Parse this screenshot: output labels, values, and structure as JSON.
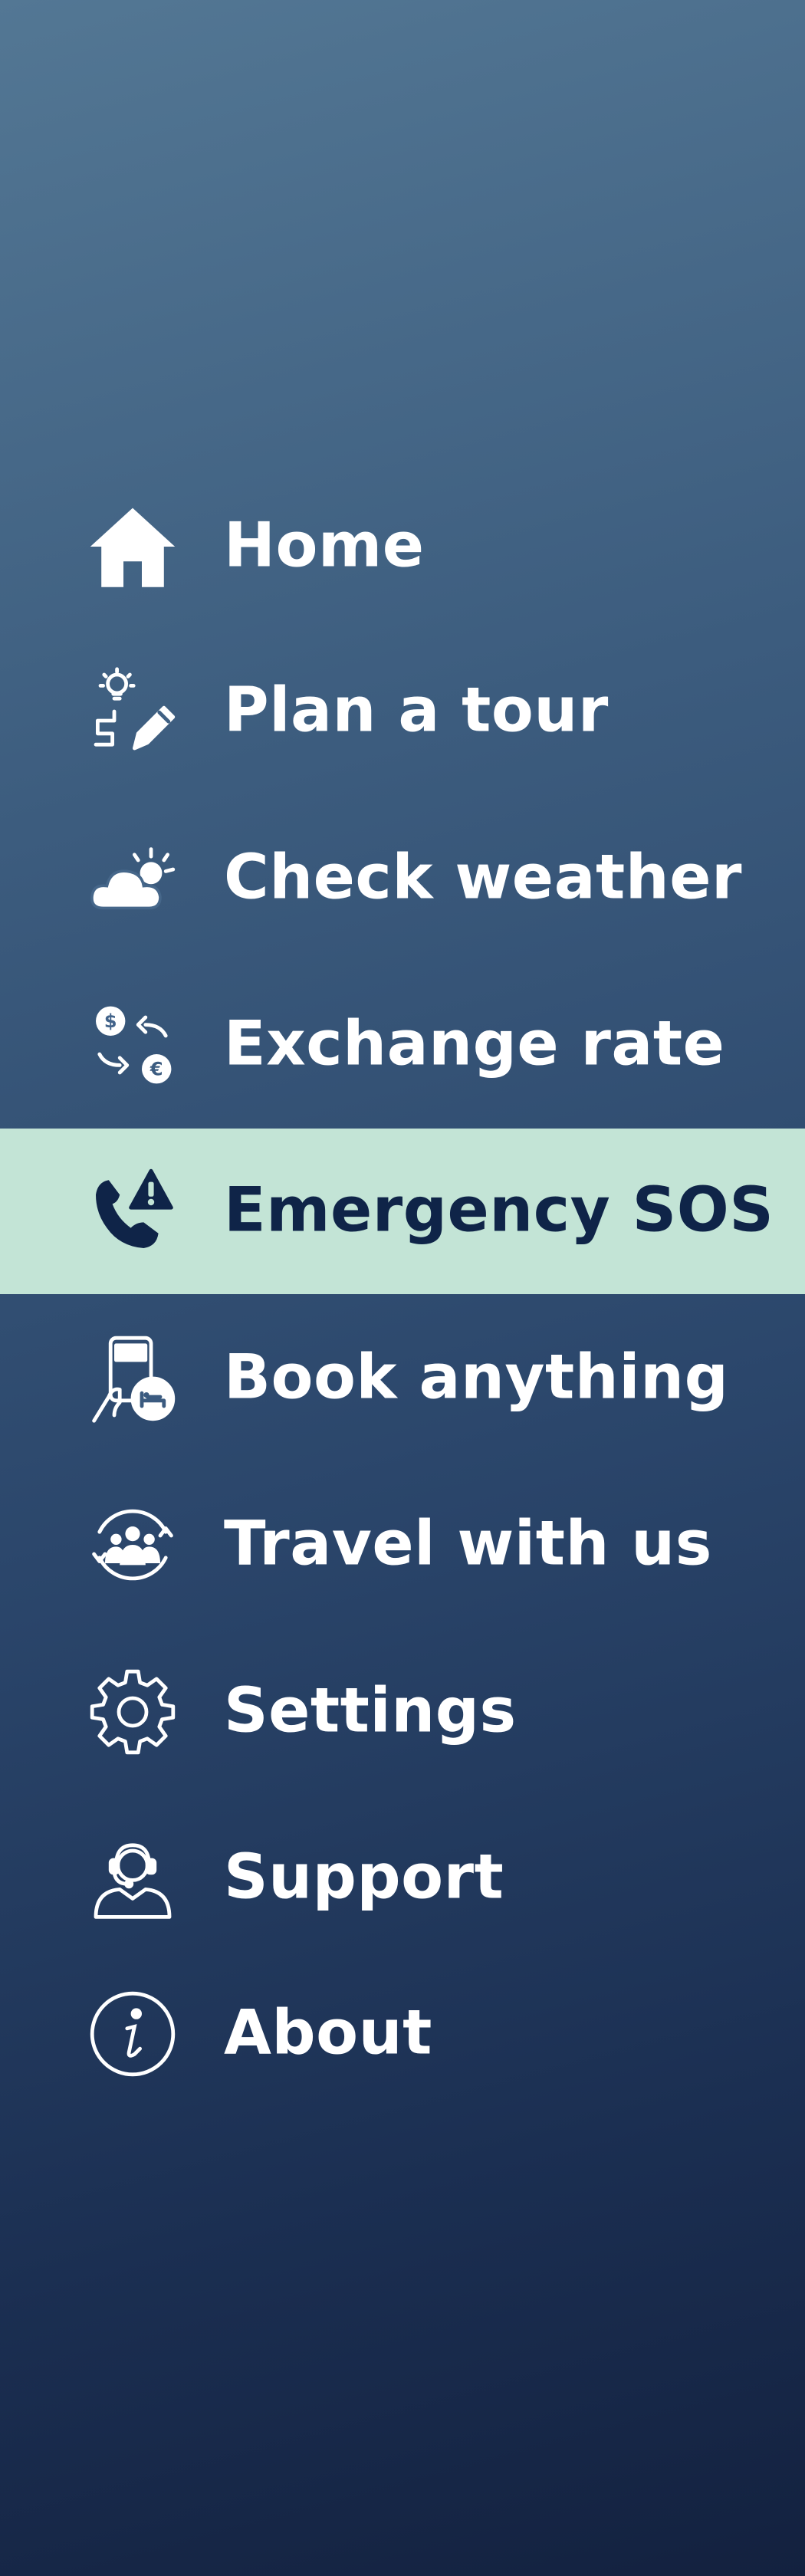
{
  "menu": {
    "active_color": "#c3e4d6",
    "active_text_color": "#0f2448",
    "items": [
      {
        "label": "Home",
        "icon": "home-icon"
      },
      {
        "label": "Plan a tour",
        "icon": "plan-tour-icon"
      },
      {
        "label": "Check weather",
        "icon": "weather-icon"
      },
      {
        "label": "Exchange rate",
        "icon": "currency-exchange-icon"
      },
      {
        "label": "Emergency SOS",
        "icon": "emergency-phone-icon",
        "active": true
      },
      {
        "label": "Book anything",
        "icon": "booking-icon"
      },
      {
        "label": "Travel with us",
        "icon": "group-travel-icon"
      },
      {
        "label": "Settings",
        "icon": "gear-icon"
      },
      {
        "label": "Support",
        "icon": "support-agent-icon"
      },
      {
        "label": "About",
        "icon": "info-icon"
      }
    ]
  }
}
